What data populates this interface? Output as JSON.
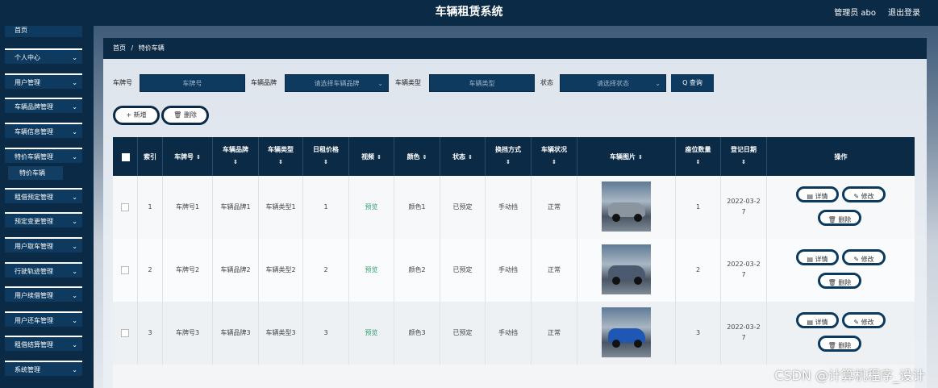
{
  "header": {
    "title": "车辆租赁系统",
    "user": "管理员 abo",
    "logout": "退出登录"
  },
  "sidebar": {
    "top_item": "首页",
    "items": [
      {
        "label": "个人中心"
      },
      {
        "label": "用户管理"
      },
      {
        "label": "车辆品牌管理"
      },
      {
        "label": "车辆信息管理"
      },
      {
        "label": "特价车辆管理"
      },
      {
        "label": "租借预定管理"
      },
      {
        "label": "预定变更管理"
      },
      {
        "label": "用户取车管理"
      },
      {
        "label": "行驶轨迹管理"
      },
      {
        "label": "用户续借管理"
      },
      {
        "label": "用户还车管理"
      },
      {
        "label": "租借结算管理"
      },
      {
        "label": "系统管理"
      }
    ],
    "sub_item": "特价车辆"
  },
  "breadcrumb": {
    "home": "首页",
    "sep": "/",
    "current": "特价车辆"
  },
  "filters": {
    "plate_label": "车牌号",
    "plate_placeholder": "车牌号",
    "brand_label": "车辆品牌",
    "brand_placeholder": "请选择车辆品牌",
    "type_label": "车辆类型",
    "type_placeholder": "车辆类型",
    "status_label": "状态",
    "status_placeholder": "请选择状态",
    "query": "查询"
  },
  "actions": {
    "add": "新增",
    "delete": "删除"
  },
  "table": {
    "columns": [
      "索引",
      "车牌号",
      "车辆品牌",
      "车辆类型",
      "日租价格",
      "视频",
      "颜色",
      "状态",
      "换挡方式",
      "车辆状况",
      "车辆图片",
      "座位数量",
      "登记日期",
      "操作"
    ],
    "rows": [
      {
        "index": "1",
        "plate": "车牌号1",
        "brand": "车辆品牌1",
        "type": "车辆类型1",
        "price": "1",
        "video": "预览",
        "color": "颜色1",
        "status": "已预定",
        "gear": "手动挡",
        "condition": "正常",
        "seats": "1",
        "date1": "2022-03-2",
        "date2": "7"
      },
      {
        "index": "2",
        "plate": "车牌号2",
        "brand": "车辆品牌2",
        "type": "车辆类型2",
        "price": "2",
        "video": "预览",
        "color": "颜色2",
        "status": "已预定",
        "gear": "手动挡",
        "condition": "正常",
        "seats": "2",
        "date1": "2022-03-2",
        "date2": "7"
      },
      {
        "index": "3",
        "plate": "车牌号3",
        "brand": "车辆品牌3",
        "type": "车辆类型3",
        "price": "3",
        "video": "预览",
        "color": "颜色3",
        "status": "已预定",
        "gear": "手动挡",
        "condition": "正常",
        "seats": "3",
        "date1": "2022-03-2",
        "date2": "7"
      }
    ],
    "ops": {
      "detail": "详情",
      "edit": "修改",
      "delete": "删除"
    },
    "car_colors": [
      "#8a95a0",
      "#4b5a6e",
      "#1f57b5"
    ]
  },
  "icons": {
    "sort": "⇕",
    "chevron": "⌄",
    "plus": "+",
    "trash": "🗑",
    "search": "Q",
    "detail": "▤",
    "edit": "✎"
  },
  "watermark": "CSDN @计算机程序_设计"
}
